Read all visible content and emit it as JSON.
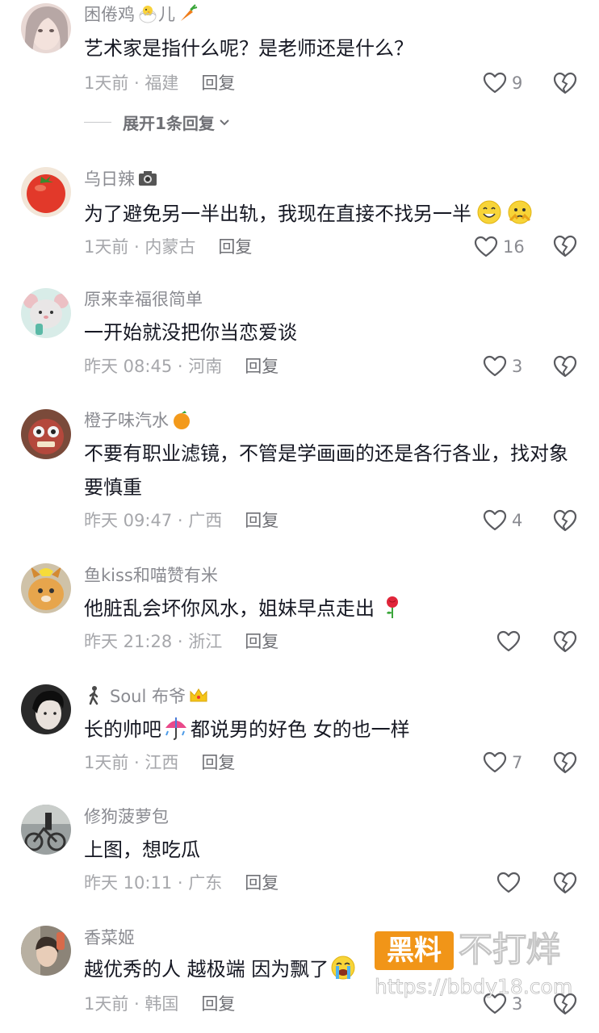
{
  "comments": [
    {
      "username": "困倦鸡",
      "username_suffix": "儿",
      "text": "艺术家是指什么呢？是老师还是什么？",
      "time_location": "1天前 · 福建",
      "reply_label": "回复",
      "likes": "9",
      "expand_label": "展开1条回复"
    },
    {
      "username": "乌日辣",
      "text": "为了避免另一半出轨，我现在直接不找另一半",
      "time_location": "1天前 · 内蒙古",
      "reply_label": "回复",
      "likes": "16"
    },
    {
      "username": "原来幸福很简单",
      "text": "一开始就没把你当恋爱谈",
      "time_location": "昨天 08:45 · 河南",
      "reply_label": "回复",
      "likes": "3"
    },
    {
      "username": "橙子味汽水",
      "text": "不要有职业滤镜，不管是学画画的还是各行各业，找对象要慎重",
      "time_location": "昨天 09:47 · 广西",
      "reply_label": "回复",
      "likes": "4"
    },
    {
      "username": "鱼kiss和喵赞有米",
      "text": "他脏乱会坏你风水，姐妹早点走出",
      "time_location": "昨天 21:28 · 浙江",
      "reply_label": "回复",
      "likes": ""
    },
    {
      "username": "Soul 布爷",
      "text_a": "长的帅吧",
      "text_b": "都说男的好色 女的也一样",
      "time_location": "1天前 · 江西",
      "reply_label": "回复",
      "likes": "7"
    },
    {
      "username": "修狗菠萝包",
      "text": "上图，想吃瓜",
      "time_location": "昨天 10:11 · 广东",
      "reply_label": "回复",
      "likes": ""
    },
    {
      "username": "香菜姬",
      "text": "越优秀的人 越极端 因为飘了",
      "time_location": "1天前 · 韩国",
      "reply_label": "回复",
      "likes": "3"
    }
  ],
  "watermark": {
    "badge": "黑料",
    "title": "不打烊",
    "url": "https://bbdy18.com"
  },
  "colors": {
    "username": "#8a8b91",
    "text": "#161823",
    "meta": "#a6a7ab",
    "accent": "#f08a00"
  },
  "icons": {
    "like": "heart-outline-icon",
    "dislike": "broken-heart-icon",
    "expand": "chevron-down-icon"
  }
}
